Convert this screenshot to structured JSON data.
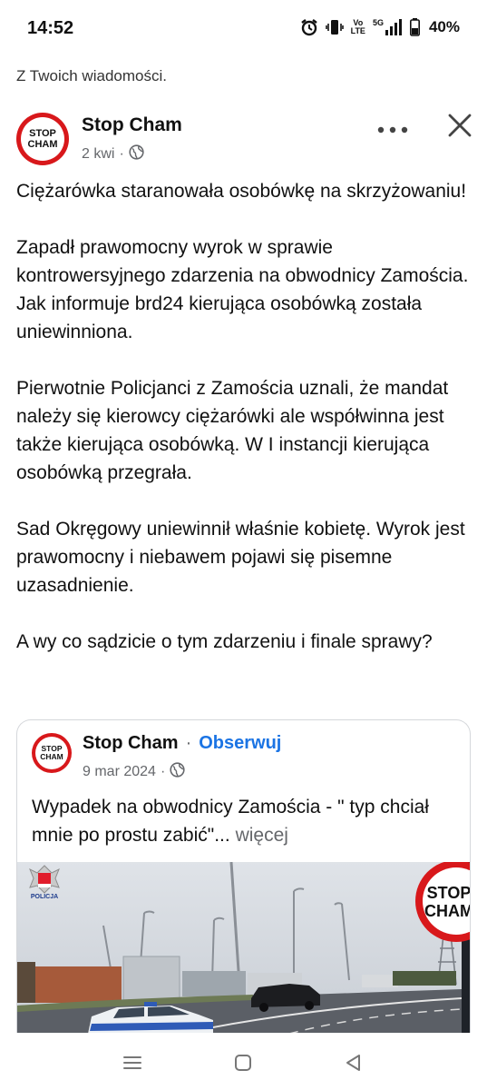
{
  "status_bar": {
    "time": "14:52",
    "volte": "Vo",
    "lte": "LTE",
    "network": "5G",
    "battery": "40%",
    "icons": [
      "alarm-icon",
      "vibrate-icon",
      "signal-icon",
      "battery-icon"
    ]
  },
  "context": {
    "label": "Z Twoich wiadomości."
  },
  "post": {
    "author": "Stop Cham",
    "logo_top": "STOP",
    "logo_bottom": "CHAM",
    "time": "2 kwi",
    "separator": "·",
    "paragraphs": [
      "Ciężarówka staranowała osobówkę na skrzyżowaniu!",
      "Zapadł prawomocny wyrok w sprawie kontrowersyjnego zdarzenia na obwodnicy Zamościa. Jak informuje brd24 kierująca osobówką została uniewinniona.",
      "Pierwotnie Policjanci z Zamościa uznali, że mandat należy się kierowcy ciężarówki  ale współwinna jest także kierująca osobówką. W I instancji kierująca osobówką przegrała.",
      "Sad Okręgowy uniewinnił właśnie kobietę. Wyrok jest prawomocny i niebawem pojawi się pisemne uzasadnienie.",
      "A wy co sądzicie o tym zdarzeniu i finale sprawy?"
    ]
  },
  "shared": {
    "author": "Stop Cham",
    "separator": "·",
    "follow": "Obserwuj",
    "date": "9 mar 2024",
    "dot": "·",
    "text": "Wypadek  na obwodnicy Zamościa - \" typ chciał mnie po prostu zabić\"...",
    "more": "więcej",
    "media": {
      "watermark_top": "STOP",
      "watermark_bottom": "CHAM",
      "police_label": "POLICJA"
    }
  },
  "colors": {
    "accent": "#1b74e4",
    "brand_red": "#d8181b",
    "muted": "#65676b"
  }
}
